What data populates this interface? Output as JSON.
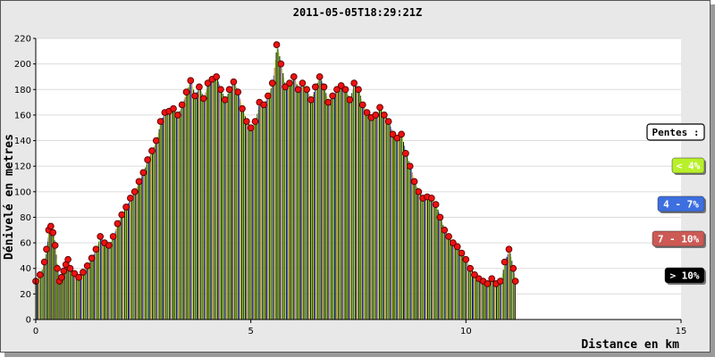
{
  "chart_data": {
    "type": "bar",
    "title": "2011-05-05T18:29:21Z",
    "xlabel": "Distance en km",
    "ylabel": "Dénivelé en metres",
    "xlim": [
      0,
      15
    ],
    "ylim": [
      0,
      220
    ],
    "x_ticks": [
      "0",
      "5",
      "10",
      "15"
    ],
    "y_ticks": [
      "0",
      "20",
      "40",
      "60",
      "80",
      "100",
      "120",
      "140",
      "160",
      "180",
      "200",
      "220"
    ],
    "grid": true,
    "legend_position": "right",
    "legend_title": "Pentes :",
    "legend": [
      {
        "label": "< 4%",
        "color": "#b8f02a",
        "text_color": "#ffffff"
      },
      {
        "label": "4 - 7%",
        "color": "#3d6fe0",
        "text_color": "#ffffff"
      },
      {
        "label": "7 - 10%",
        "color": "#cc5a55",
        "text_color": "#ffffff"
      },
      {
        "label": "> 10%",
        "color": "#000000",
        "text_color": "#ffffff"
      }
    ],
    "series": [
      {
        "marker_color": "#ee1111",
        "points": [
          [
            0.0,
            30
          ],
          [
            0.1,
            35
          ],
          [
            0.2,
            45
          ],
          [
            0.25,
            55
          ],
          [
            0.3,
            70
          ],
          [
            0.35,
            73
          ],
          [
            0.4,
            68
          ],
          [
            0.45,
            58
          ],
          [
            0.5,
            40
          ],
          [
            0.55,
            30
          ],
          [
            0.6,
            33
          ],
          [
            0.65,
            38
          ],
          [
            0.7,
            43
          ],
          [
            0.75,
            47
          ],
          [
            0.8,
            40
          ],
          [
            0.9,
            36
          ],
          [
            1.0,
            33
          ],
          [
            1.1,
            37
          ],
          [
            1.2,
            42
          ],
          [
            1.3,
            48
          ],
          [
            1.4,
            55
          ],
          [
            1.5,
            65
          ],
          [
            1.6,
            60
          ],
          [
            1.7,
            58
          ],
          [
            1.8,
            65
          ],
          [
            1.9,
            75
          ],
          [
            2.0,
            82
          ],
          [
            2.1,
            88
          ],
          [
            2.2,
            95
          ],
          [
            2.3,
            100
          ],
          [
            2.4,
            108
          ],
          [
            2.5,
            115
          ],
          [
            2.6,
            125
          ],
          [
            2.7,
            132
          ],
          [
            2.8,
            140
          ],
          [
            2.9,
            155
          ],
          [
            3.0,
            162
          ],
          [
            3.1,
            163
          ],
          [
            3.2,
            165
          ],
          [
            3.3,
            160
          ],
          [
            3.4,
            168
          ],
          [
            3.5,
            178
          ],
          [
            3.6,
            187
          ],
          [
            3.7,
            175
          ],
          [
            3.8,
            182
          ],
          [
            3.9,
            173
          ],
          [
            4.0,
            185
          ],
          [
            4.1,
            188
          ],
          [
            4.2,
            190
          ],
          [
            4.3,
            180
          ],
          [
            4.4,
            172
          ],
          [
            4.5,
            180
          ],
          [
            4.6,
            186
          ],
          [
            4.7,
            178
          ],
          [
            4.8,
            165
          ],
          [
            4.9,
            155
          ],
          [
            5.0,
            150
          ],
          [
            5.1,
            155
          ],
          [
            5.2,
            170
          ],
          [
            5.3,
            168
          ],
          [
            5.4,
            175
          ],
          [
            5.5,
            185
          ],
          [
            5.6,
            215
          ],
          [
            5.7,
            200
          ],
          [
            5.8,
            182
          ],
          [
            5.9,
            185
          ],
          [
            6.0,
            190
          ],
          [
            6.1,
            180
          ],
          [
            6.2,
            185
          ],
          [
            6.3,
            180
          ],
          [
            6.4,
            172
          ],
          [
            6.5,
            182
          ],
          [
            6.6,
            190
          ],
          [
            6.7,
            182
          ],
          [
            6.8,
            170
          ],
          [
            6.9,
            175
          ],
          [
            7.0,
            180
          ],
          [
            7.1,
            183
          ],
          [
            7.2,
            180
          ],
          [
            7.3,
            172
          ],
          [
            7.4,
            185
          ],
          [
            7.5,
            180
          ],
          [
            7.6,
            168
          ],
          [
            7.7,
            162
          ],
          [
            7.8,
            158
          ],
          [
            7.9,
            160
          ],
          [
            8.0,
            166
          ],
          [
            8.1,
            160
          ],
          [
            8.2,
            155
          ],
          [
            8.3,
            145
          ],
          [
            8.4,
            142
          ],
          [
            8.5,
            145
          ],
          [
            8.6,
            130
          ],
          [
            8.7,
            120
          ],
          [
            8.8,
            108
          ],
          [
            8.9,
            100
          ],
          [
            9.0,
            95
          ],
          [
            9.1,
            96
          ],
          [
            9.2,
            95
          ],
          [
            9.3,
            90
          ],
          [
            9.4,
            80
          ],
          [
            9.5,
            70
          ],
          [
            9.6,
            65
          ],
          [
            9.7,
            60
          ],
          [
            9.8,
            57
          ],
          [
            9.9,
            52
          ],
          [
            10.0,
            47
          ],
          [
            10.1,
            40
          ],
          [
            10.2,
            35
          ],
          [
            10.3,
            32
          ],
          [
            10.4,
            30
          ],
          [
            10.5,
            28
          ],
          [
            10.6,
            32
          ],
          [
            10.7,
            28
          ],
          [
            10.8,
            30
          ],
          [
            10.9,
            45
          ],
          [
            11.0,
            55
          ],
          [
            11.1,
            40
          ],
          [
            11.15,
            30
          ]
        ]
      }
    ]
  }
}
